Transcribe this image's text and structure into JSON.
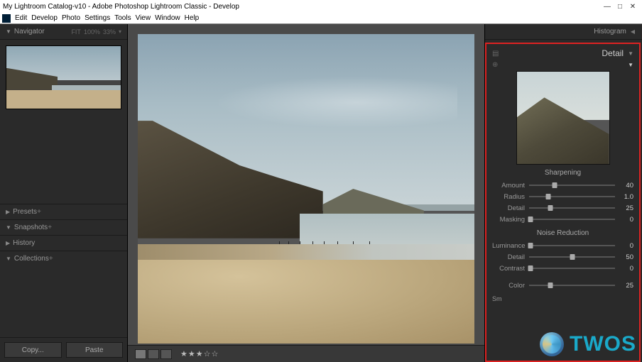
{
  "window": {
    "title": "My Lightroom Catalog-v10 - Adobe Photoshop Lightroom Classic - Develop"
  },
  "menu": [
    "Edit",
    "Develop",
    "Photo",
    "Settings",
    "Tools",
    "View",
    "Window",
    "Help"
  ],
  "navigator": {
    "label": "Navigator",
    "zoom_modes": [
      "FIT",
      "100%",
      "33%"
    ]
  },
  "left_panels": {
    "presets": "Presets",
    "snapshots": "Snapshots",
    "history": "History",
    "collections": "Collections"
  },
  "bottom_buttons": {
    "copy": "Copy...",
    "paste": "Paste"
  },
  "rating_display": "★★★☆☆",
  "right_panel": {
    "histogram": "Histogram",
    "detail": "Detail",
    "sharpening": {
      "title": "Sharpening",
      "amount": {
        "label": "Amount",
        "value": 40,
        "pos": 30
      },
      "radius": {
        "label": "Radius",
        "value": "1.0",
        "pos": 22
      },
      "detail": {
        "label": "Detail",
        "value": 25,
        "pos": 25
      },
      "masking": {
        "label": "Masking",
        "value": 0,
        "pos": 2
      }
    },
    "noise_reduction": {
      "title": "Noise Reduction",
      "luminance": {
        "label": "Luminance",
        "value": 0,
        "pos": 2
      },
      "detail": {
        "label": "Detail",
        "value": 50,
        "pos": 50
      },
      "contrast": {
        "label": "Contrast",
        "value": 0,
        "pos": 2
      },
      "color": {
        "label": "Color",
        "value": 25,
        "pos": 25
      }
    },
    "sm": "Sm"
  },
  "watermark": "TWOS"
}
